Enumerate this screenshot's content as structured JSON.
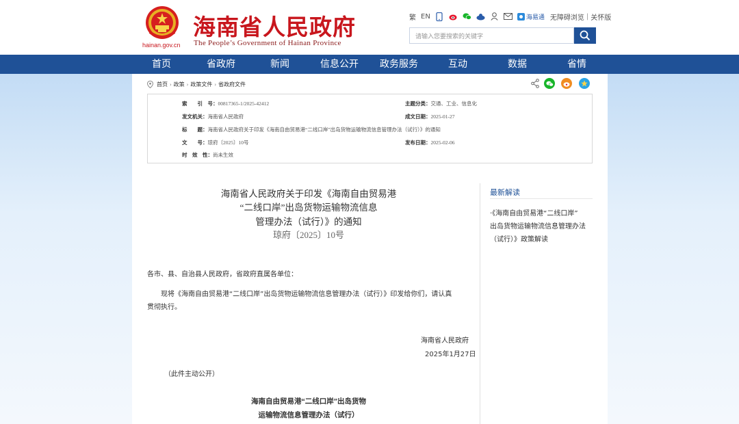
{
  "header": {
    "domain": "hainan.gov.cn",
    "title": "海南省人民政府",
    "subtitle": "The People’s Government of Hainan Province",
    "top_links": {
      "traditional": "繁",
      "english": "EN",
      "hainan_tong": "海易通",
      "accessibility": "无障碍浏览",
      "separator": "|",
      "care_version": "关怀版"
    },
    "search_placeholder": "请输入您要搜索的关键字"
  },
  "nav": {
    "items": [
      "首页",
      "省政府",
      "新闻",
      "信息公开",
      "政务服务",
      "互动",
      "数据",
      "省情"
    ]
  },
  "breadcrumb": {
    "items": [
      "首页",
      "政策",
      "政策文件",
      "省政府文件"
    ],
    "sep": "›"
  },
  "meta": {
    "index_label": "索　　引　号：",
    "index_value": "00817365-1/2025-42412",
    "topic_label": "主题分类：",
    "topic_value": "交通、工业、信息化",
    "issuer_label": "发文机关：",
    "issuer_value": "海南省人民政府",
    "created_label": "成文日期：",
    "created_value": "2025-01-27",
    "title_label": "标　　题：",
    "title_value": "海南省人民政府关于印发《海南自由贸易港“二线口岸”出岛货物运输物流信息管理办法（试行）》的通知",
    "docno_label": "文　　号：",
    "docno_value": "琼府〔2025〕10号",
    "published_label": "发布日期：",
    "published_value": "2025-02-06",
    "validity_label": "时　效　性：",
    "validity_value": "尚未生效"
  },
  "article": {
    "title_line1": "海南省人民政府关于印发《海南自由贸易港",
    "title_line2": "“二线口岸”出岛货物运输物流信息",
    "title_line3": "管理办法（试行）》的通知",
    "doc_number": "琼府〔2025〕10号",
    "salutation": "各市、县、自治县人民政府，省政府直属各单位：",
    "body_line1": "现将《海南自由贸易港“二线口岸”出岛货物运输物流信息管理办法（试行）》印发给你们，请认真",
    "body_line2": "贯彻执行。",
    "signer": "海南省人民政府",
    "date": "2025年1月27日",
    "disclosure": "（此件主动公开）",
    "attachment_line1": "海南自由贸易港“二线口岸”出岛货物",
    "attachment_line2": "运输物流信息管理办法（试行）"
  },
  "sidebar": {
    "heading": "最新解读",
    "line1": "·《海南自由贸易港“二线口岸”",
    "line2": "出岛货物运输物流信息管理办法",
    "line3": "（试行）》政策解读"
  },
  "colors": {
    "brand_red": "#c8161d",
    "nav_blue": "#1f5197",
    "wechat_green": "#18b52a",
    "weibo_orange": "#f08d22",
    "qzone_blue": "#2aa4e6"
  }
}
